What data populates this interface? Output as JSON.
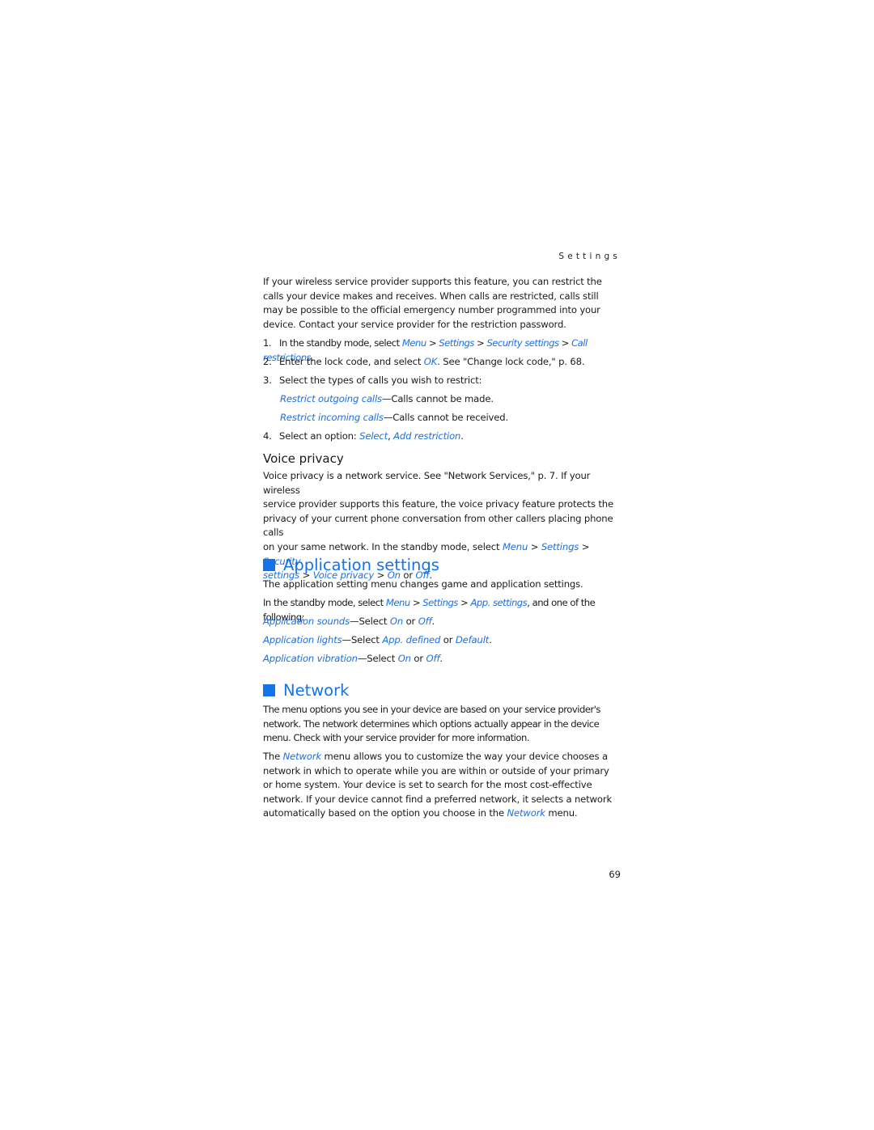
{
  "running_head": "Settings",
  "intro": "If your wireless service provider supports this feature, you can restrict the calls your device makes and receives. When calls are restricted, calls still may be possible to the official emergency number programmed into your device. Contact your service provider for the restriction password.",
  "steps": {
    "s1": {
      "num": "1.",
      "pre": "In the standby mode, select ",
      "l1": "Menu",
      "sep1": " > ",
      "l2": "Settings",
      "sep2": " > ",
      "l3": "Security settings",
      "sep3": " > ",
      "l4": "Call restrictions",
      "end": "."
    },
    "s2": {
      "num": "2.",
      "pre": "Enter the lock code, and select ",
      "l1": "OK",
      "post": ". See \"Change lock code,\" p. 68."
    },
    "s3": {
      "num": "3.",
      "text": "Select the types of calls you wish to restrict:"
    },
    "opt1": {
      "link": "Restrict outgoing calls",
      "desc": "—Calls cannot be made."
    },
    "opt2": {
      "link": "Restrict incoming calls",
      "desc": "—Calls cannot be received."
    },
    "s4": {
      "num": "4.",
      "pre": "Select an option: ",
      "l1": "Select",
      "sep": ", ",
      "l2": "Add restriction",
      "end": "."
    }
  },
  "voice_privacy": {
    "heading": "Voice privacy",
    "line1": "Voice privacy is a network service. See \"Network Services,\" p. 7. If your wireless",
    "line2": "service provider supports this feature, the voice privacy feature protects the",
    "line3": "privacy of your current phone conversation from other callers placing phone calls",
    "line4_pre": "on your same network. In the standby mode, select ",
    "l_menu": "Menu",
    "gt": " > ",
    "l_settings": "Settings",
    "l_security": "Security",
    "l_settings2": "settings",
    "l_voice": "Voice privacy",
    "l_on": "On",
    "or": " or ",
    "l_off": "Off",
    "end": "."
  },
  "app_settings": {
    "heading": "Application settings",
    "desc": "The application setting menu changes game and application settings.",
    "path_pre": "In the standby mode, select ",
    "l_menu": "Menu",
    "gt": " > ",
    "l_settings": "Settings",
    "l_app": "App. settings",
    "path_post": ", and one of the following:",
    "items": [
      {
        "link": "Application sounds",
        "desc": "—Select ",
        "a": "On",
        "or": " or ",
        "b": "Off",
        "end": "."
      },
      {
        "link": "Application lights",
        "desc": "—Select ",
        "a": "App. defined",
        "or": " or ",
        "b": "Default",
        "end": "."
      },
      {
        "link": "Application vibration",
        "desc": "—Select ",
        "a": "On",
        "or": " or ",
        "b": "Off",
        "end": "."
      }
    ]
  },
  "network": {
    "heading": "Network",
    "p1": "The menu options you see in your device are based on your service provider's network. The network determines which options actually appear in the device menu. Check with your service provider for more information.",
    "p2_pre": "The ",
    "l_network": "Network",
    "p2_mid": " menu allows you to customize the way your device chooses a network in which to operate while you are within or outside of your primary or home system. Your device is set to search for the most cost-effective network. If your device cannot find a preferred network, it selects a network automatically based on the option you choose in the ",
    "p2_end": " menu."
  },
  "page_number": "69"
}
